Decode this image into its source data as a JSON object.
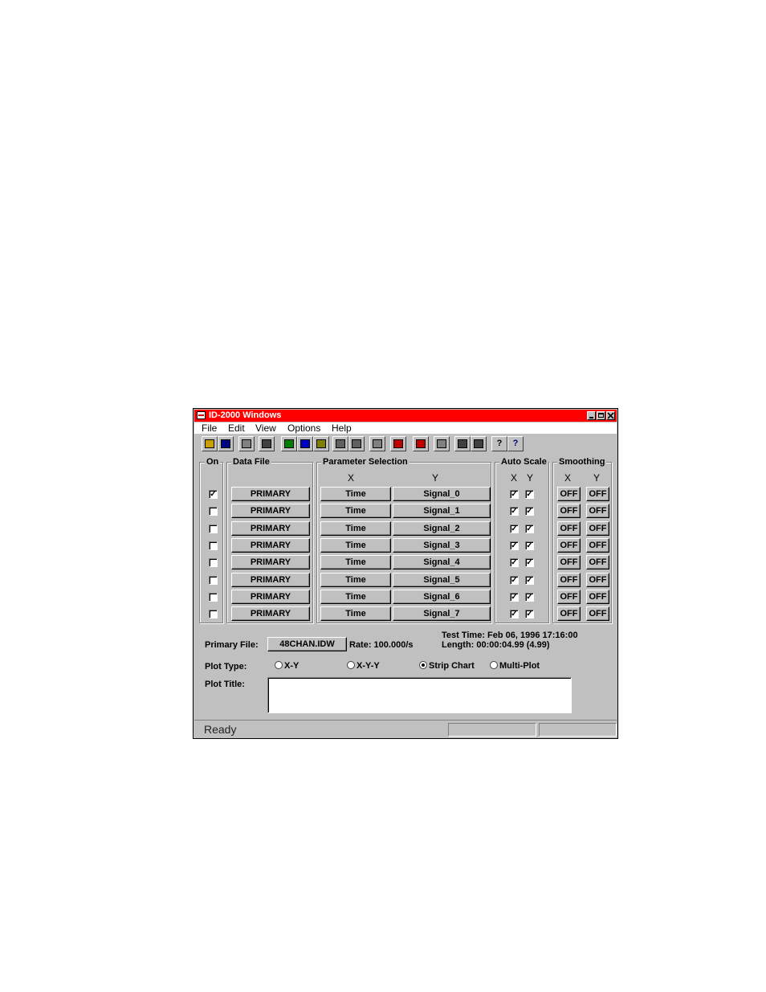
{
  "window": {
    "title": "ID-2000 Windows"
  },
  "menu": [
    "File",
    "Edit",
    "View",
    "Options",
    "Help"
  ],
  "toolbar": {
    "icons": [
      "open-icon",
      "save-icon",
      "copy-icon",
      "print-icon",
      "plot-xy-icon",
      "plot-line-icon",
      "bar-chart-icon",
      "zoom-in-icon",
      "zoom-out-icon",
      "document-icon",
      "color-bars-icon",
      "record-icon",
      "hand-icon",
      "scale-x-icon",
      "scale-y-icon",
      "help-icon",
      "context-help-icon"
    ],
    "help_glyph": "?",
    "context_help_glyph": "?"
  },
  "groups": {
    "on": "On",
    "data_file": "Data File",
    "parameter_selection": "Parameter Selection",
    "auto_scale": "Auto Scale",
    "smoothing": "Smoothing"
  },
  "headers": {
    "x": "X",
    "y": "Y"
  },
  "check_glyph": "✓",
  "rows": [
    {
      "on": true,
      "file": "PRIMARY",
      "x": "Time",
      "y": "Signal_0",
      "auto_x": true,
      "auto_y": true,
      "smooth_x": "OFF",
      "smooth_y": "OFF"
    },
    {
      "on": false,
      "file": "PRIMARY",
      "x": "Time",
      "y": "Signal_1",
      "auto_x": true,
      "auto_y": true,
      "smooth_x": "OFF",
      "smooth_y": "OFF"
    },
    {
      "on": false,
      "file": "PRIMARY",
      "x": "Time",
      "y": "Signal_2",
      "auto_x": true,
      "auto_y": true,
      "smooth_x": "OFF",
      "smooth_y": "OFF"
    },
    {
      "on": false,
      "file": "PRIMARY",
      "x": "Time",
      "y": "Signal_3",
      "auto_x": true,
      "auto_y": true,
      "smooth_x": "OFF",
      "smooth_y": "OFF"
    },
    {
      "on": false,
      "file": "PRIMARY",
      "x": "Time",
      "y": "Signal_4",
      "auto_x": true,
      "auto_y": true,
      "smooth_x": "OFF",
      "smooth_y": "OFF"
    },
    {
      "on": false,
      "file": "PRIMARY",
      "x": "Time",
      "y": "Signal_5",
      "auto_x": true,
      "auto_y": true,
      "smooth_x": "OFF",
      "smooth_y": "OFF"
    },
    {
      "on": false,
      "file": "PRIMARY",
      "x": "Time",
      "y": "Signal_6",
      "auto_x": true,
      "auto_y": true,
      "smooth_x": "OFF",
      "smooth_y": "OFF"
    },
    {
      "on": false,
      "file": "PRIMARY",
      "x": "Time",
      "y": "Signal_7",
      "auto_x": true,
      "auto_y": true,
      "smooth_x": "OFF",
      "smooth_y": "OFF"
    }
  ],
  "primary": {
    "label": "Primary File:",
    "file": "48CHAN.IDW",
    "rate": "Rate: 100.000/s",
    "test_time": "Test Time: Feb 06, 1996  17:16:00",
    "length": "Length: 00:00:04.99  (4.99)"
  },
  "plot_type": {
    "label": "Plot Type:",
    "options": [
      {
        "label": "X-Y",
        "selected": false
      },
      {
        "label": "X-Y-Y",
        "selected": false
      },
      {
        "label": "Strip Chart",
        "selected": true
      },
      {
        "label": "Multi-Plot",
        "selected": false
      }
    ]
  },
  "plot_title": {
    "label": "Plot Title:",
    "value": ""
  },
  "status": {
    "text": "Ready"
  },
  "colors": {
    "titlebar": "#ff0000",
    "face": "#c0c0c0"
  }
}
